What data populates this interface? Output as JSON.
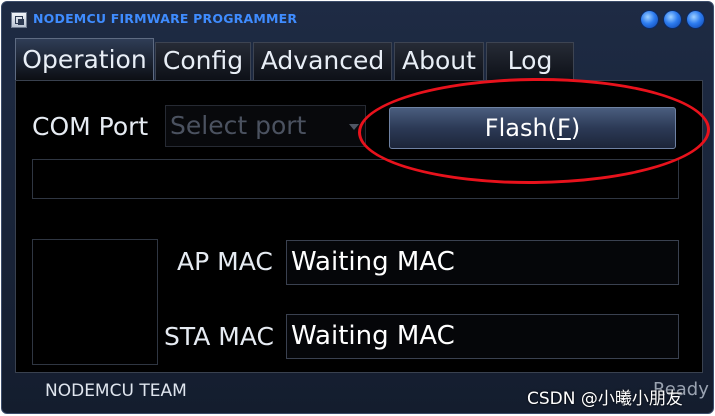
{
  "window": {
    "title": "NODEMCU FIRMWARE PROGRAMMER"
  },
  "tabs": [
    {
      "label": "Operation"
    },
    {
      "label": "Config"
    },
    {
      "label": "Advanced"
    },
    {
      "label": "About"
    },
    {
      "label": "Log"
    }
  ],
  "operation": {
    "com_port_label": "COM Port",
    "port_select": {
      "placeholder": "Select port"
    },
    "flash_button": {
      "label_prefix": "Flash(",
      "accel_key": "F",
      "label_suffix": ")"
    },
    "ap_mac": {
      "label": "AP MAC",
      "value": "Waiting MAC"
    },
    "sta_mac": {
      "label": "STA MAC",
      "value": "Waiting MAC"
    }
  },
  "status_bar": {
    "team": "NODEMCU TEAM",
    "status": "Ready"
  },
  "watermark": "CSDN @小曦小朋友",
  "colors": {
    "accent": "#3f8cff",
    "annotation": "#e8121c",
    "background": "#000000"
  }
}
